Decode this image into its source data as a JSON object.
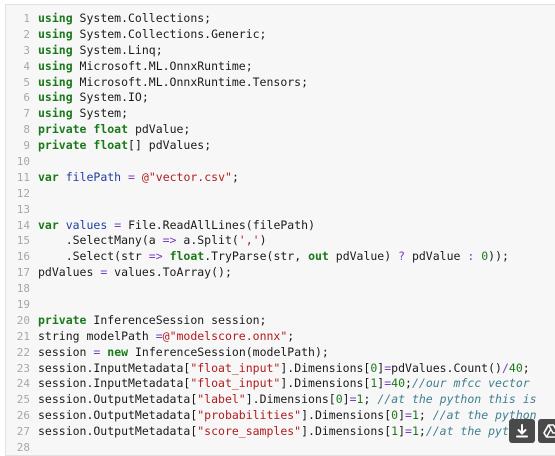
{
  "lines": [
    {
      "n": "1",
      "t": [
        {
          "c": "kw",
          "v": "using"
        },
        {
          "c": "txt",
          "v": " System.Collections;"
        }
      ]
    },
    {
      "n": "2",
      "t": [
        {
          "c": "kw",
          "v": "using"
        },
        {
          "c": "txt",
          "v": " System.Collections.Generic;"
        }
      ]
    },
    {
      "n": "3",
      "t": [
        {
          "c": "kw",
          "v": "using"
        },
        {
          "c": "txt",
          "v": " System.Linq;"
        }
      ]
    },
    {
      "n": "4",
      "t": [
        {
          "c": "kw",
          "v": "using"
        },
        {
          "c": "txt",
          "v": " Microsoft.ML.OnnxRuntime;"
        }
      ]
    },
    {
      "n": "5",
      "t": [
        {
          "c": "kw",
          "v": "using"
        },
        {
          "c": "txt",
          "v": " Microsoft.ML.OnnxRuntime.Tensors;"
        }
      ]
    },
    {
      "n": "6",
      "t": [
        {
          "c": "kw",
          "v": "using"
        },
        {
          "c": "txt",
          "v": " System.IO;"
        }
      ]
    },
    {
      "n": "7",
      "t": [
        {
          "c": "kw",
          "v": "using"
        },
        {
          "c": "txt",
          "v": " System;"
        }
      ]
    },
    {
      "n": "8",
      "t": [
        {
          "c": "kw",
          "v": "private"
        },
        {
          "c": "txt",
          "v": " "
        },
        {
          "c": "kw",
          "v": "float"
        },
        {
          "c": "txt",
          "v": " pdValue;"
        }
      ]
    },
    {
      "n": "9",
      "t": [
        {
          "c": "kw",
          "v": "private"
        },
        {
          "c": "txt",
          "v": " "
        },
        {
          "c": "kw",
          "v": "float"
        },
        {
          "c": "txt",
          "v": "[] pdValues;"
        }
      ]
    },
    {
      "n": "10",
      "t": []
    },
    {
      "n": "11",
      "t": [
        {
          "c": "kw",
          "v": "var"
        },
        {
          "c": "txt",
          "v": " "
        },
        {
          "c": "var",
          "v": "filePath"
        },
        {
          "c": "txt",
          "v": " "
        },
        {
          "c": "op",
          "v": "="
        },
        {
          "c": "txt",
          "v": " "
        },
        {
          "c": "str",
          "v": "@\"vector.csv\""
        },
        {
          "c": "txt",
          "v": ";"
        }
      ]
    },
    {
      "n": "12",
      "t": []
    },
    {
      "n": "13",
      "t": []
    },
    {
      "n": "14",
      "t": [
        {
          "c": "kw",
          "v": "var"
        },
        {
          "c": "txt",
          "v": " "
        },
        {
          "c": "var",
          "v": "values"
        },
        {
          "c": "txt",
          "v": " "
        },
        {
          "c": "op",
          "v": "="
        },
        {
          "c": "txt",
          "v": " File.ReadAllLines(filePath)"
        }
      ]
    },
    {
      "n": "15",
      "t": [
        {
          "c": "txt",
          "v": "    .SelectMany(a "
        },
        {
          "c": "op",
          "v": "=>"
        },
        {
          "c": "txt",
          "v": " a.Split("
        },
        {
          "c": "str",
          "v": "','"
        },
        {
          "c": "txt",
          "v": ")"
        }
      ]
    },
    {
      "n": "16",
      "t": [
        {
          "c": "txt",
          "v": "    .Select(str "
        },
        {
          "c": "op",
          "v": "=>"
        },
        {
          "c": "txt",
          "v": " "
        },
        {
          "c": "kw",
          "v": "float"
        },
        {
          "c": "txt",
          "v": ".TryParse(str, "
        },
        {
          "c": "kw",
          "v": "out"
        },
        {
          "c": "txt",
          "v": " pdValue) "
        },
        {
          "c": "op",
          "v": "?"
        },
        {
          "c": "txt",
          "v": " pdValue "
        },
        {
          "c": "op",
          "v": ":"
        },
        {
          "c": "txt",
          "v": " "
        },
        {
          "c": "num",
          "v": "0"
        },
        {
          "c": "txt",
          "v": "));"
        }
      ]
    },
    {
      "n": "17",
      "t": [
        {
          "c": "txt",
          "v": "pdValues "
        },
        {
          "c": "op",
          "v": "="
        },
        {
          "c": "txt",
          "v": " values.ToArray();"
        }
      ]
    },
    {
      "n": "18",
      "t": []
    },
    {
      "n": "19",
      "t": []
    },
    {
      "n": "20",
      "t": [
        {
          "c": "kw",
          "v": "private"
        },
        {
          "c": "txt",
          "v": " InferenceSession session;"
        }
      ]
    },
    {
      "n": "21",
      "t": [
        {
          "c": "txt",
          "v": "string modelPath "
        },
        {
          "c": "op",
          "v": "="
        },
        {
          "c": "str",
          "v": "@\"modelscore.onnx\""
        },
        {
          "c": "txt",
          "v": ";"
        }
      ]
    },
    {
      "n": "22",
      "t": [
        {
          "c": "txt",
          "v": "session "
        },
        {
          "c": "op",
          "v": "="
        },
        {
          "c": "txt",
          "v": " "
        },
        {
          "c": "kw",
          "v": "new"
        },
        {
          "c": "txt",
          "v": " InferenceSession(modelPath);"
        }
      ]
    },
    {
      "n": "23",
      "t": [
        {
          "c": "txt",
          "v": "session.InputMetadata["
        },
        {
          "c": "str",
          "v": "\"float_input\""
        },
        {
          "c": "txt",
          "v": "].Dimensions["
        },
        {
          "c": "num",
          "v": "0"
        },
        {
          "c": "txt",
          "v": "]"
        },
        {
          "c": "op",
          "v": "="
        },
        {
          "c": "txt",
          "v": "pdValues.Count()"
        },
        {
          "c": "op",
          "v": "/"
        },
        {
          "c": "num",
          "v": "40"
        },
        {
          "c": "txt",
          "v": ";"
        }
      ]
    },
    {
      "n": "24",
      "t": [
        {
          "c": "txt",
          "v": "session.InputMetadata["
        },
        {
          "c": "str",
          "v": "\"float_input\""
        },
        {
          "c": "txt",
          "v": "].Dimensions["
        },
        {
          "c": "num",
          "v": "1"
        },
        {
          "c": "txt",
          "v": "]"
        },
        {
          "c": "op",
          "v": "="
        },
        {
          "c": "num",
          "v": "40"
        },
        {
          "c": "txt",
          "v": ";"
        },
        {
          "c": "cmt",
          "v": "//our mfcc vector"
        }
      ]
    },
    {
      "n": "25",
      "t": [
        {
          "c": "txt",
          "v": "session.OutputMetadata["
        },
        {
          "c": "str",
          "v": "\"label\""
        },
        {
          "c": "txt",
          "v": "].Dimensions["
        },
        {
          "c": "num",
          "v": "0"
        },
        {
          "c": "txt",
          "v": "]"
        },
        {
          "c": "op",
          "v": "="
        },
        {
          "c": "num",
          "v": "1"
        },
        {
          "c": "txt",
          "v": "; "
        },
        {
          "c": "cmt",
          "v": "//at the python this is"
        }
      ]
    },
    {
      "n": "26",
      "t": [
        {
          "c": "txt",
          "v": "session.OutputMetadata["
        },
        {
          "c": "str",
          "v": "\"probabilities\""
        },
        {
          "c": "txt",
          "v": "].Dimensions["
        },
        {
          "c": "num",
          "v": "0"
        },
        {
          "c": "txt",
          "v": "]"
        },
        {
          "c": "op",
          "v": "="
        },
        {
          "c": "num",
          "v": "1"
        },
        {
          "c": "txt",
          "v": "; "
        },
        {
          "c": "cmt",
          "v": "//at the python"
        }
      ]
    },
    {
      "n": "27",
      "t": [
        {
          "c": "txt",
          "v": "session.OutputMetadata["
        },
        {
          "c": "str",
          "v": "\"score_samples\""
        },
        {
          "c": "txt",
          "v": "].Dimensions["
        },
        {
          "c": "num",
          "v": "1"
        },
        {
          "c": "txt",
          "v": "]"
        },
        {
          "c": "op",
          "v": "="
        },
        {
          "c": "num",
          "v": "1"
        },
        {
          "c": "txt",
          "v": ";"
        },
        {
          "c": "cmt",
          "v": "//at the python"
        }
      ]
    },
    {
      "n": "28",
      "t": []
    }
  ],
  "overlay": {
    "download_icon": "download-arrow-icon",
    "drive_icon": "drive-triangle-icon"
  }
}
